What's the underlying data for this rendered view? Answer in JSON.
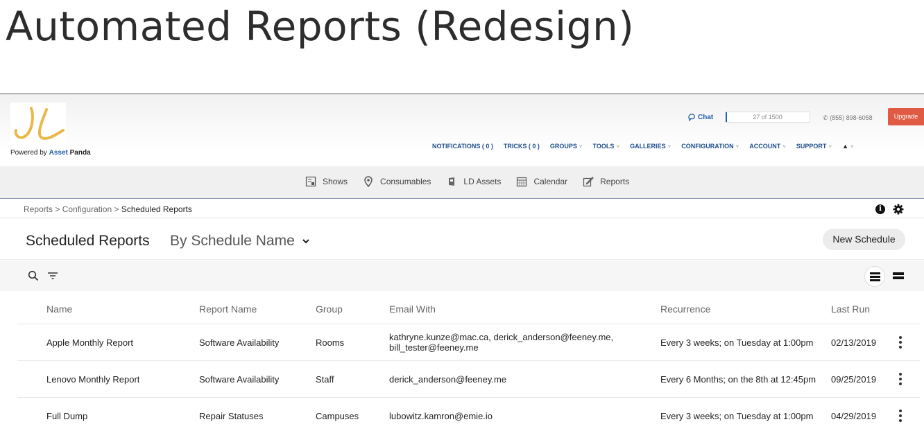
{
  "page_title": "Automated Reports (Redesign)",
  "brand": {
    "logo_text": "JL",
    "powered_by_prefix": "Powered by",
    "powered_by_brand1": "Asset",
    "powered_by_brand2": "Panda"
  },
  "utility": {
    "chat_label": "Chat",
    "usage_text": "27 of 1500",
    "usage_fraction": 0.018,
    "phone": "(855) 898-6058",
    "upgrade_label": "Upgrade"
  },
  "main_nav": [
    {
      "label": "NOTIFICATIONS ( 0 )",
      "dropdown": false
    },
    {
      "label": "TRICKS ( 0 )",
      "dropdown": false
    },
    {
      "label": "GROUPS",
      "dropdown": true
    },
    {
      "label": "TOOLS",
      "dropdown": true
    },
    {
      "label": "GALLERIES",
      "dropdown": true
    },
    {
      "label": "CONFIGURATION",
      "dropdown": true
    },
    {
      "label": "ACCOUNT",
      "dropdown": true
    },
    {
      "label": "SUPPORT",
      "dropdown": true
    }
  ],
  "modules": {
    "shows": "Shows",
    "consumables": "Consumables",
    "ld_assets": "LD Assets",
    "calendar": "Calendar",
    "reports": "Reports"
  },
  "breadcrumb": {
    "part1": "Reports",
    "part2": "Configuration",
    "current": "Scheduled Reports",
    "separator": ">"
  },
  "header": {
    "title": "Scheduled Reports",
    "sort_label": "By Schedule Name",
    "new_button": "New Schedule"
  },
  "table": {
    "columns": {
      "name": "Name",
      "report": "Report Name",
      "group": "Group",
      "email": "Email With",
      "recurrence": "Recurrence",
      "last_run": "Last Run"
    },
    "rows": [
      {
        "name": "Apple Monthly Report",
        "report": "Software Availability",
        "group": "Rooms",
        "email": "kathryne.kunze@mac.ca, derick_anderson@feeney.me, bill_tester@feeney.me",
        "recurrence": "Every 3 weeks; on Tuesday at 1:00pm",
        "last_run": "02/13/2019"
      },
      {
        "name": "Lenovo Monthly Report",
        "report": "Software Availability",
        "group": "Staff",
        "email": "derick_anderson@feeney.me",
        "recurrence": "Every 6 Months; on the 8th at 12:45pm",
        "last_run": "09/25/2019"
      },
      {
        "name": "Full Dump",
        "report": "Repair Statuses",
        "group": "Campuses",
        "email": "lubowitz.kamron@emie.io",
        "recurrence": "Every 3 weeks; on Tuesday at 1:00pm",
        "last_run": "04/29/2019"
      }
    ]
  },
  "colors": {
    "accent_blue": "#1f5fa6",
    "nav_blue": "#1f4e8c",
    "upgrade_red": "#e05a44",
    "logo_gold": "#e8b84a"
  }
}
